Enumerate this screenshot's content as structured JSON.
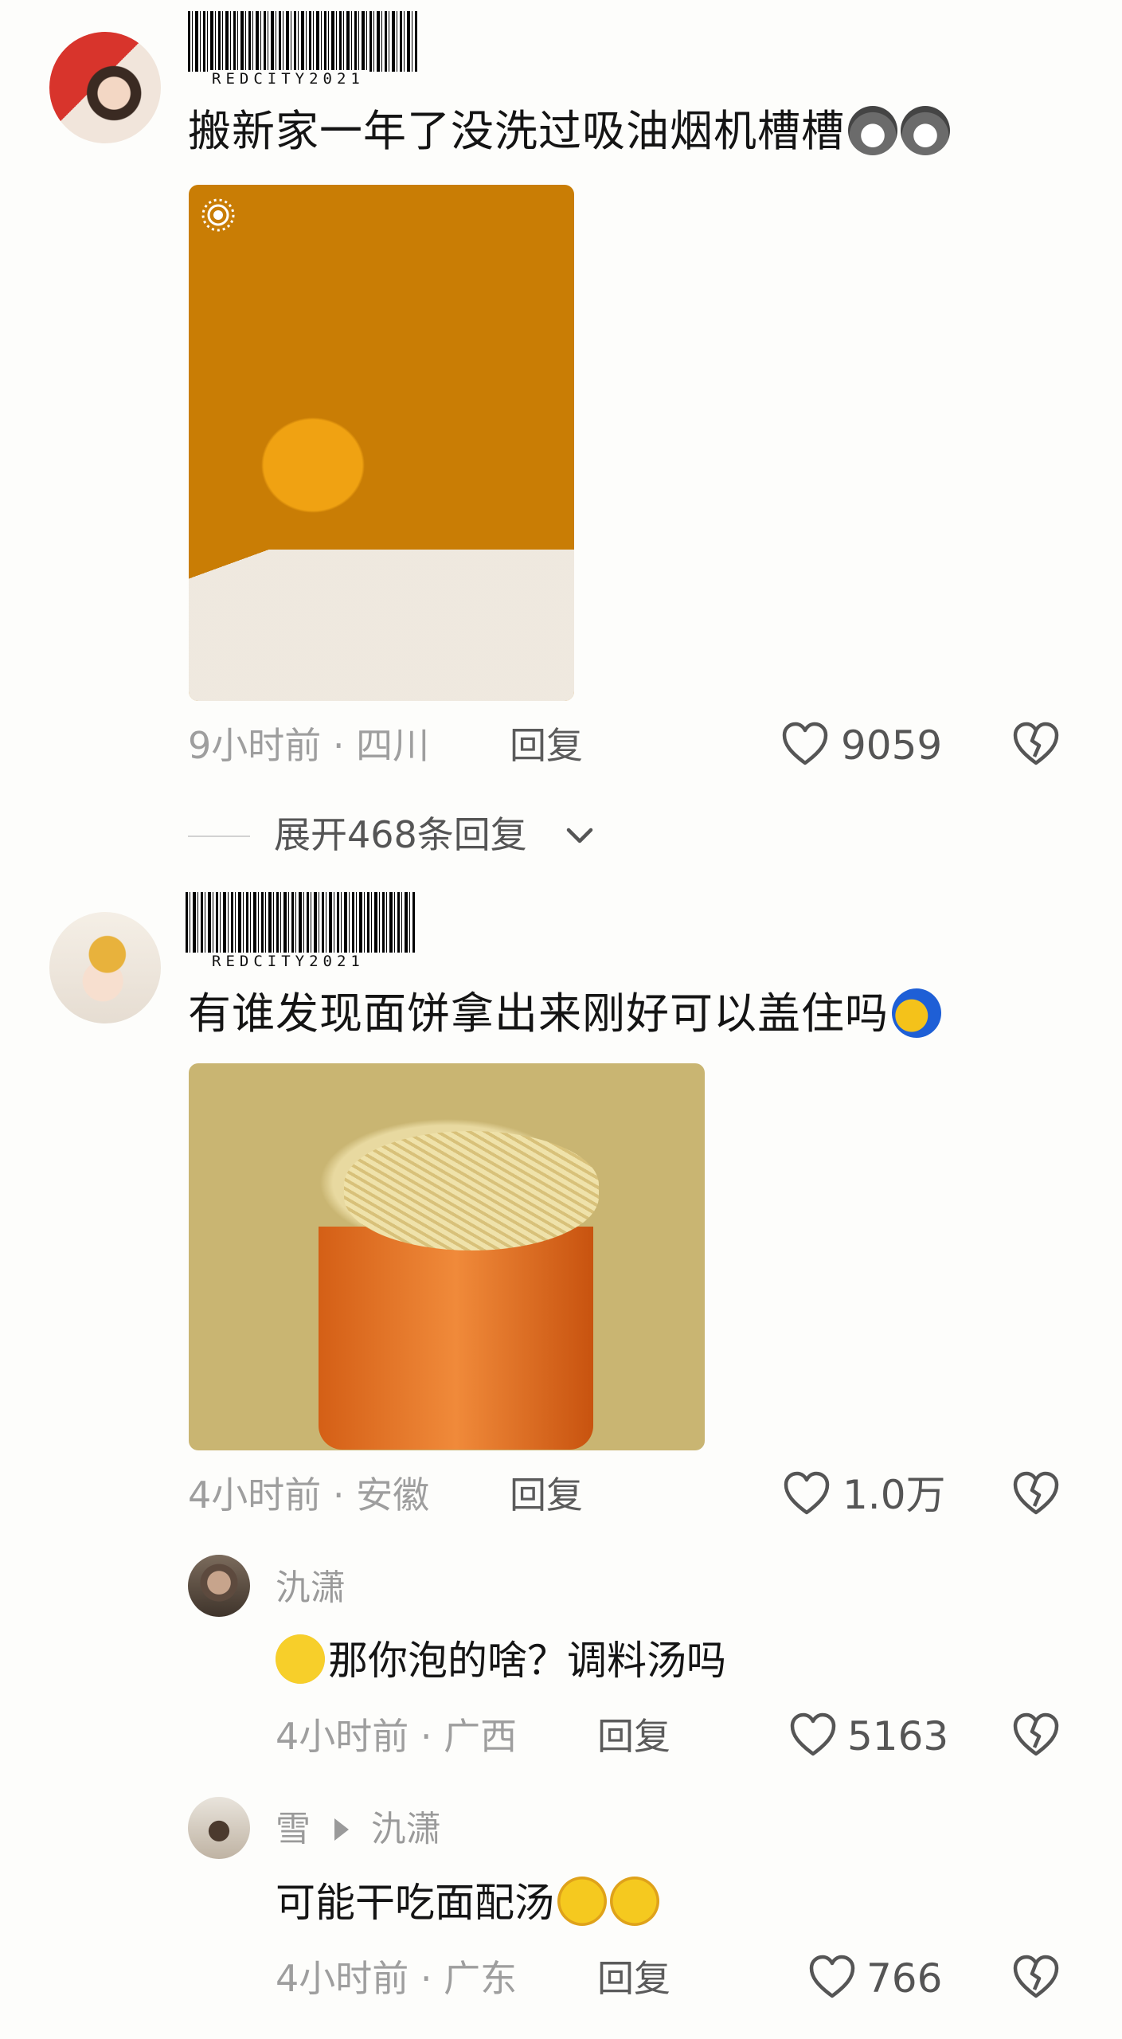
{
  "comments": [
    {
      "barcode_caption": "REDCITY2021",
      "text": "搬新家一年了没洗过吸油烟机槽槽",
      "emojis": [
        "wolf-emoji",
        "wolf-emoji"
      ],
      "time": "9小时前",
      "location": "四川",
      "reply_label": "回复",
      "likes": "9059",
      "expand_label": "展开468条回复"
    },
    {
      "barcode_caption": "REDCITY2021",
      "text": "有谁发现面饼拿出来刚好可以盖住吗",
      "emojis": [
        "cover-face-emoji"
      ],
      "time": "4小时前",
      "location": "安徽",
      "reply_label": "回复",
      "likes": "1.0万",
      "replies": [
        {
          "username": "氿潇",
          "text": "那你泡的啥？调料汤吗",
          "emojis": [
            "side-glance-emoji"
          ],
          "time": "4小时前",
          "location": "广西",
          "reply_label": "回复",
          "likes": "5163"
        },
        {
          "username": "雪",
          "reply_to": "氿潇",
          "text": "可能干吃面配汤",
          "emojis": [
            "crying-emoji",
            "crying-emoji"
          ],
          "time": "4小时前",
          "location": "广东",
          "reply_label": "回复",
          "likes": "766"
        }
      ]
    }
  ],
  "separator": "·",
  "colors": {
    "background": "#fdfdfb",
    "meta_text": "#9e9e9e",
    "primary_text": "#141414"
  }
}
